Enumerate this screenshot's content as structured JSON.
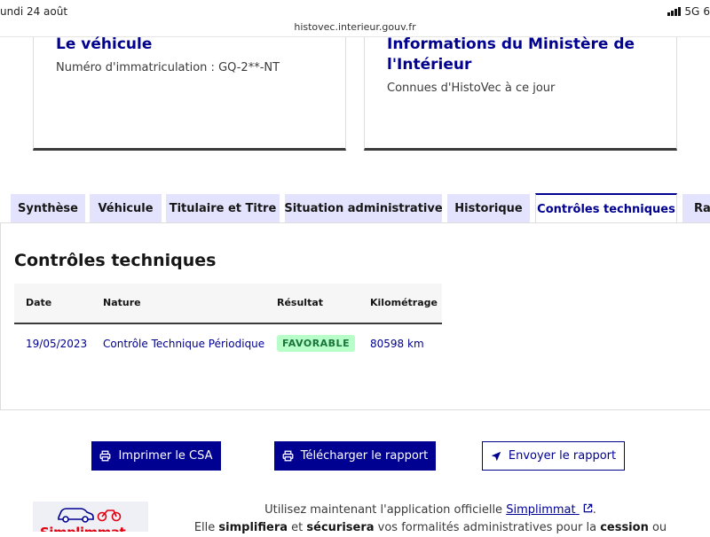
{
  "status_bar": {
    "date": "undi 24 août",
    "network": "5G",
    "battery": "6"
  },
  "browser": {
    "url": "histovec.interieur.gouv.fr"
  },
  "cards": {
    "vehicule": {
      "title": "Le véhicule",
      "subtitle": "Numéro d'immatriculation : GQ-2**-NT"
    },
    "info": {
      "title": "Informations du Ministère de l'Intérieur",
      "subtitle": "Connues d'HistoVec à ce jour"
    }
  },
  "tabs": [
    {
      "label": "Synthèse"
    },
    {
      "label": "Véhicule"
    },
    {
      "label": "Titulaire et Titre"
    },
    {
      "label": "Situation administrative"
    },
    {
      "label": "Historique"
    },
    {
      "label": "Contrôles techniques"
    },
    {
      "label": "Rap"
    }
  ],
  "active_tab": "Contrôles techniques",
  "panel": {
    "title": "Contrôles techniques",
    "columns": [
      "Date",
      "Nature",
      "Résultat",
      "Kilométrage"
    ],
    "rows": [
      {
        "date": "19/05/2023",
        "nature": "Contrôle Technique Périodique",
        "resultat": "FAVORABLE",
        "kilometrage": "80598 km"
      }
    ]
  },
  "actions": {
    "print": "Imprimer le CSA",
    "download": "Télécharger le rapport",
    "send": "Envoyer le rapport"
  },
  "promo": {
    "line1_before": "Utilisez maintenant l'application officielle",
    "app_name": "Simplimmat",
    "line1_after": ".",
    "line2_a": "Elle",
    "line2_b": "simplifiera",
    "line2_c": "et",
    "line2_d": "sécurisera",
    "line2_e": "vos formalités administratives pour la",
    "line2_f": "cession",
    "line2_g": "ou",
    "logo_text": "Simplimmat"
  },
  "colors": {
    "primary": "#000091",
    "tab_bg": "#e3e3fd",
    "success_bg": "#b8fec9",
    "success_text": "#18753c"
  }
}
